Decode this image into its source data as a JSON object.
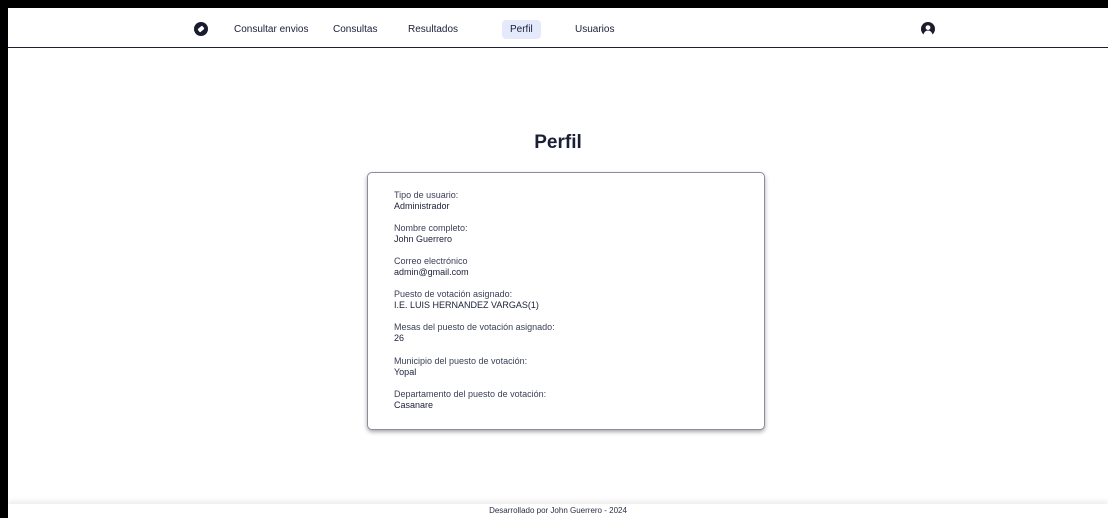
{
  "nav": {
    "items": [
      {
        "label": "Consultar envios"
      },
      {
        "label": "Consultas"
      },
      {
        "label": "Resultados"
      },
      {
        "label": "Perfil",
        "active": true
      },
      {
        "label": "Usuarios"
      }
    ]
  },
  "page": {
    "title": "Perfil"
  },
  "profile": {
    "fields": [
      {
        "label": "Tipo de usuario:",
        "value": "Administrador"
      },
      {
        "label": "Nombre completo:",
        "value": "John Guerrero"
      },
      {
        "label": "Correo electrónico",
        "value": "admin@gmail.com"
      },
      {
        "label": "Puesto de votación asignado:",
        "value": "I.E. LUIS HERNANDEZ VARGAS(1)"
      },
      {
        "label": "Mesas del puesto de votación asignado:",
        "value": "26"
      },
      {
        "label": "Municipio del puesto de votación:",
        "value": "Yopal"
      },
      {
        "label": "Departamento del puesto de votación:",
        "value": "Casanare"
      }
    ]
  },
  "footer": {
    "text": "Desarrollado por John Guerrero - 2024"
  },
  "colors": {
    "text": "#1a1f36",
    "active_tab_bg": "#e4e9fb",
    "card_border": "#8a8f9c"
  },
  "icons": {
    "logo": "compass-logo-icon",
    "avatar": "user-avatar-icon"
  }
}
